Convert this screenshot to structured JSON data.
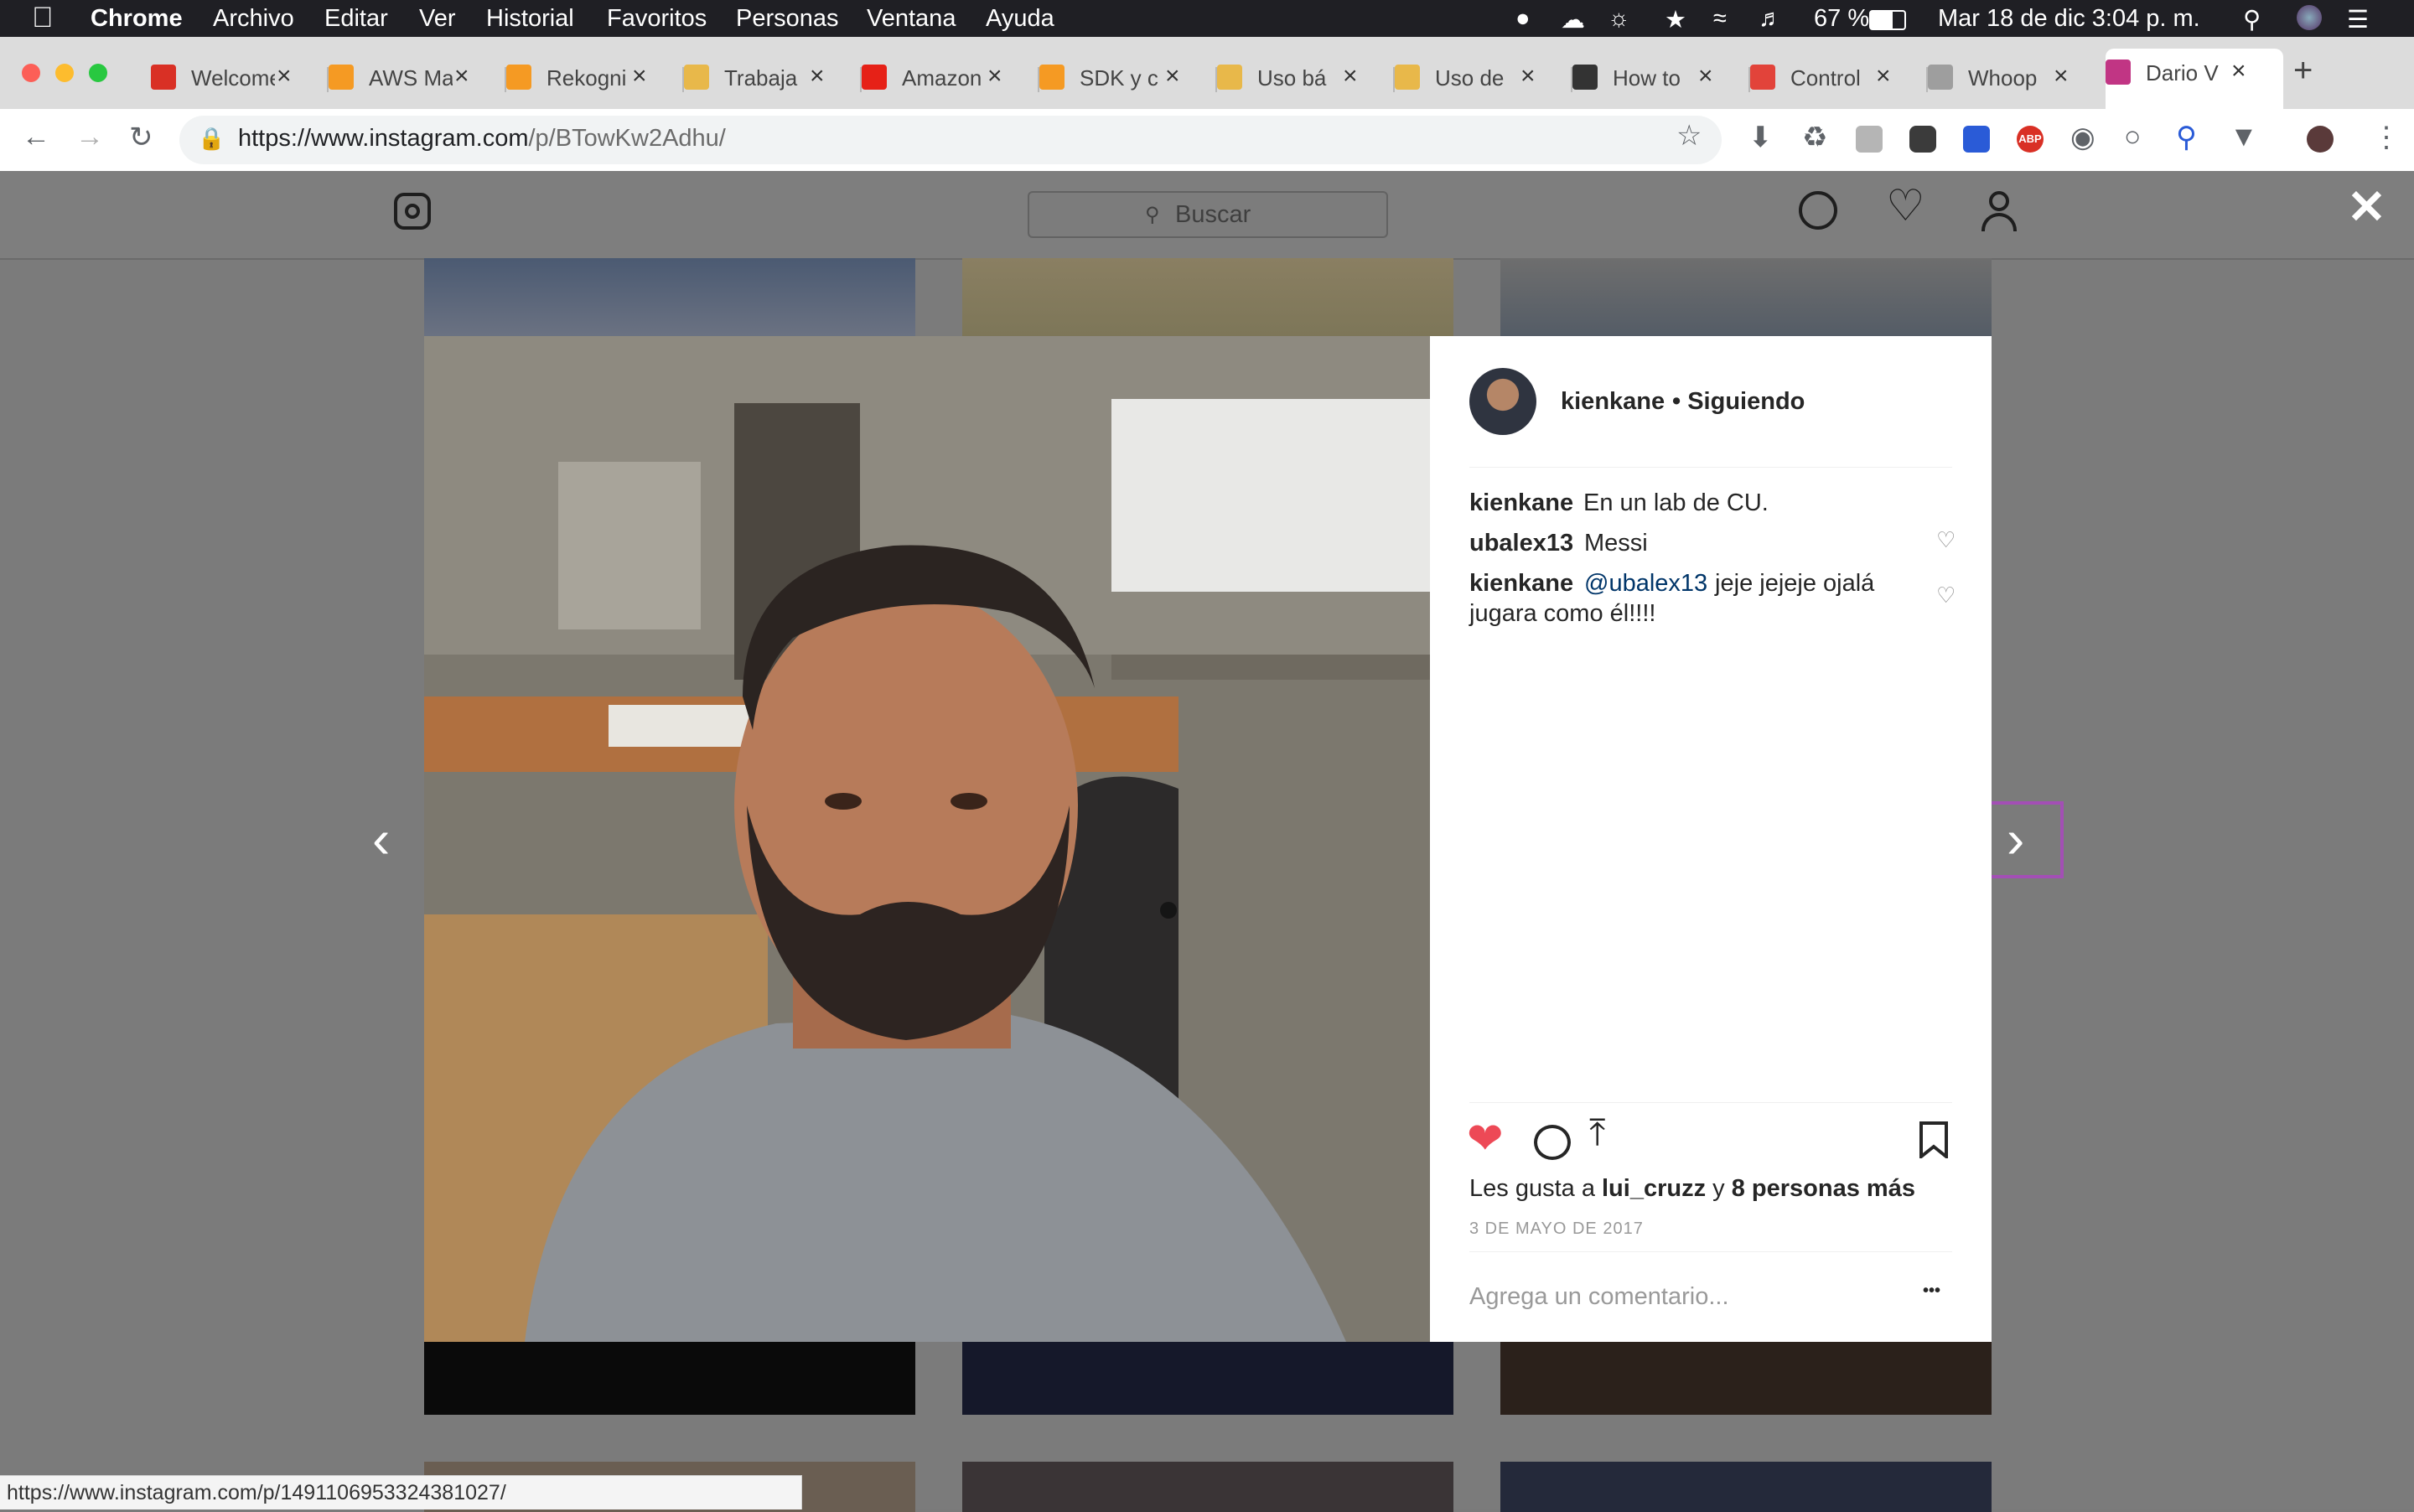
{
  "menubar": {
    "app": "Chrome",
    "menus": [
      "Archivo",
      "Editar",
      "Ver",
      "Historial",
      "Favoritos",
      "Personas",
      "Ventana",
      "Ayuda"
    ],
    "battery": "67 %",
    "datetime": "Mar 18 de dic  3:04 p. m."
  },
  "tabs": [
    {
      "label": "Welcome",
      "color": "#d93025"
    },
    {
      "label": "AWS Ma",
      "color": "#f59a23"
    },
    {
      "label": "Rekogni",
      "color": "#f59a23"
    },
    {
      "label": "Trabaja",
      "color": "#e8b84a"
    },
    {
      "label": "Amazon",
      "color": "#e62117"
    },
    {
      "label": "SDK y c",
      "color": "#f59a23"
    },
    {
      "label": "Uso bá",
      "color": "#e8b84a"
    },
    {
      "label": "Uso de",
      "color": "#e8b84a"
    },
    {
      "label": "How to",
      "color": "#333333"
    },
    {
      "label": "Control",
      "color": "#e2433a"
    },
    {
      "label": "Whoop",
      "color": "#9e9e9e"
    },
    {
      "label": "Dario V",
      "color": "#c13584"
    }
  ],
  "address": {
    "host": "https://www.instagram.com",
    "path": "/p/BTowKw2Adhu/"
  },
  "instagram": {
    "search_placeholder": "Buscar",
    "post": {
      "username": "kienkane",
      "follow_status": "• Siguiendo",
      "comments": [
        {
          "user": "kienkane",
          "text": "En un lab de CU."
        },
        {
          "user": "ubalex13",
          "text": "Messi"
        },
        {
          "user": "kienkane",
          "mention": "@ubalex13",
          "text": " jeje jejeje ojalá",
          "text2": "jugara como él!!!!"
        }
      ],
      "likes_prefix": "Les gusta a ",
      "likes_user": "lui_cruzz",
      "likes_mid": " y ",
      "likes_count": "8 personas más",
      "date": "3 DE MAYO DE 2017",
      "comment_placeholder": "Agrega un comentario...",
      "more": "•••"
    }
  },
  "status_url": "https://www.instagram.com/p/1491106953324381027/",
  "colors": {
    "liked_heart": "#ed4956",
    "mention": "#003569",
    "brand_highlight": "#a34fb5"
  }
}
